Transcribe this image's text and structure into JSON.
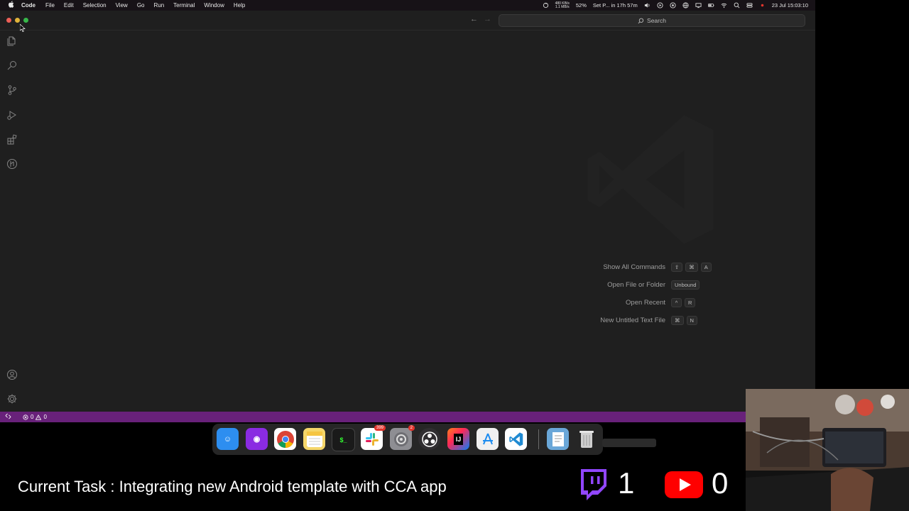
{
  "menubar": {
    "items": [
      "Code",
      "File",
      "Edit",
      "Selection",
      "View",
      "Go",
      "Run",
      "Terminal",
      "Window",
      "Help"
    ],
    "net_up": "480 KB/s",
    "net_down": "1.1 MB/s",
    "battery_pct": "52%",
    "reminder": "Set P... in 17h 57m",
    "datetime": "23 Jul  15:03:10"
  },
  "titlebar": {
    "search_label": "Search"
  },
  "activity_bar": {
    "icons": [
      "files-icon",
      "search-icon",
      "source-control-icon",
      "run-debug-icon",
      "extensions-icon",
      "git-graph-icon",
      "account-icon",
      "settings-gear-icon"
    ]
  },
  "welcome": {
    "shortcuts": [
      {
        "label": "Show All Commands",
        "keys": [
          "⇧",
          "⌘",
          "A"
        ]
      },
      {
        "label": "Open File or Folder",
        "keys": [
          "Unbound"
        ]
      },
      {
        "label": "Open Recent",
        "keys": [
          "^",
          "R"
        ]
      },
      {
        "label": "New Untitled Text File",
        "keys": [
          "⌘",
          "N"
        ]
      }
    ]
  },
  "statusbar": {
    "errors": "0",
    "warnings": "0"
  },
  "dock": {
    "apps": [
      {
        "name": "Finder",
        "icon": "finder-icon",
        "color": "#2d8ef0"
      },
      {
        "name": "Podcasts",
        "icon": "podcasts-icon",
        "color": "#8a2be2"
      },
      {
        "name": "Chrome",
        "icon": "chrome-icon",
        "color": "#ffffff"
      },
      {
        "name": "Notes",
        "icon": "notes-icon",
        "color": "#f5d66a"
      },
      {
        "name": "Terminal",
        "icon": "terminal-icon",
        "color": "#1a1a1a"
      },
      {
        "name": "Slack",
        "icon": "slack-icon",
        "color": "#ffffff",
        "badge": "399"
      },
      {
        "name": "System Preferences",
        "icon": "system-preferences-icon",
        "color": "#8e8e93",
        "badge": "2"
      },
      {
        "name": "OBS",
        "icon": "obs-icon",
        "color": "#302e31"
      },
      {
        "name": "IntelliJ IDEA",
        "icon": "intellij-icon",
        "color": "#1a1aa8"
      },
      {
        "name": "App Store",
        "icon": "app-store-icon",
        "color": "#f0f0f0"
      },
      {
        "name": "VS Code",
        "icon": "vscode-icon",
        "color": "#ffffff"
      },
      {
        "name": "Documents",
        "icon": "documents-icon",
        "color": "#6aa7d8"
      },
      {
        "name": "Trash",
        "icon": "trash-icon",
        "color": "#cfcfcf"
      }
    ]
  },
  "overlay": {
    "task": "Current Task : Integrating new Android template with CCA app",
    "twitch_count": "1",
    "youtube_count": "0"
  }
}
